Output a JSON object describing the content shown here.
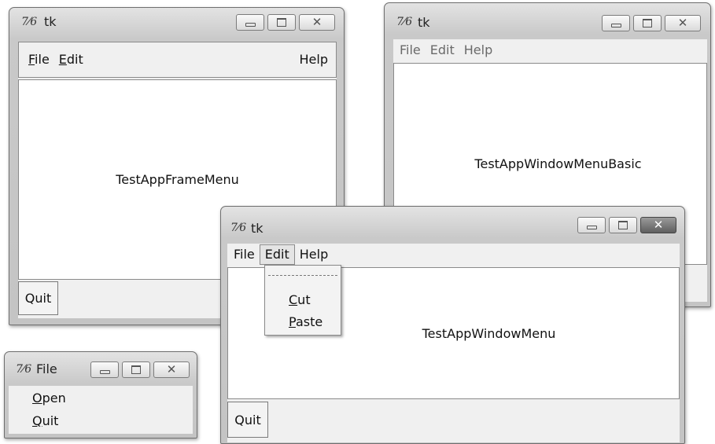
{
  "window_frame_menu": {
    "icon": "tk-feather-icon",
    "title": "tk",
    "menu": {
      "file": {
        "underline": "F",
        "rest": "ile"
      },
      "edit": {
        "underline": "E",
        "rest": "dit"
      },
      "help": "Help"
    },
    "content_label": "TestAppFrameMenu",
    "quit_label": "Quit"
  },
  "window_menu_basic": {
    "icon": "tk-feather-icon",
    "title": "tk",
    "menu": {
      "file": "File",
      "edit": "Edit",
      "help": "Help"
    },
    "content_label": "TestAppWindowMenuBasic"
  },
  "window_menu": {
    "icon": "tk-feather-icon",
    "title": "tk",
    "menu": {
      "file": "File",
      "edit": "Edit",
      "help": "Help"
    },
    "dropdown": {
      "cut": {
        "underline": "C",
        "rest": "ut"
      },
      "paste": {
        "underline": "P",
        "rest": "aste"
      }
    },
    "content_label": "TestAppWindowMenu",
    "quit_label": "Quit"
  },
  "file_torn_menu": {
    "icon": "tk-feather-icon",
    "title": "File",
    "items": {
      "open": {
        "underline": "O",
        "rest": "pen"
      },
      "quit": {
        "underline": "Q",
        "rest": "uit"
      }
    }
  },
  "colors": {
    "active_close": "#6a6a6a",
    "client_bg": "#f0f0f0",
    "content_bg": "#ffffff"
  }
}
